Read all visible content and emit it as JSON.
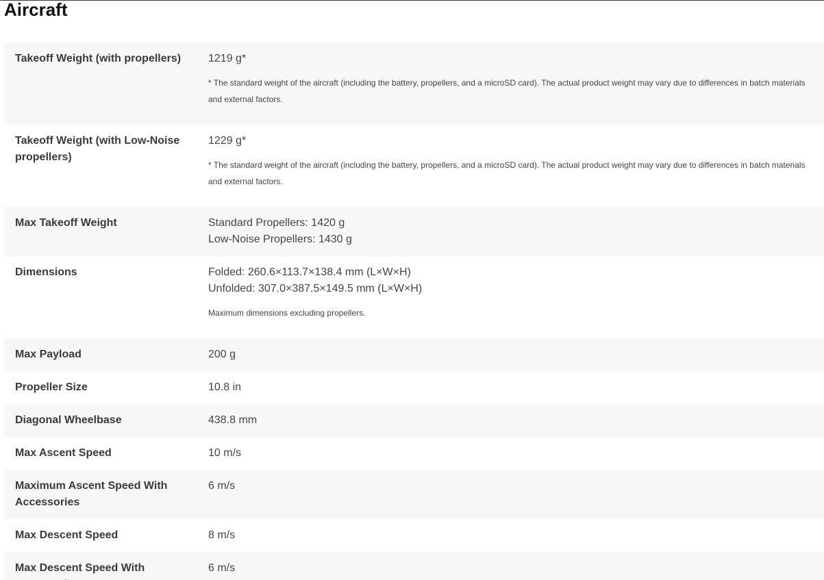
{
  "section": {
    "title": "Aircraft"
  },
  "specs": [
    {
      "label": "Takeoff Weight (with propellers)",
      "values": [
        "1219 g*"
      ],
      "note": "* The standard weight of the aircraft (including the battery, propellers, and a microSD card). The actual product weight may vary due to differences in batch materials and external factors."
    },
    {
      "label": "Takeoff Weight (with Low-Noise propellers)",
      "values": [
        "1229 g*"
      ],
      "note": "* The standard weight of the aircraft (including the battery, propellers, and a microSD card). The actual product weight may vary due to differences in batch materials and external factors."
    },
    {
      "label": "Max Takeoff Weight",
      "values": [
        "Standard Propellers: 1420 g",
        "Low-Noise Propellers: 1430 g"
      ]
    },
    {
      "label": "Dimensions",
      "values": [
        "Folded: 260.6×113.7×138.4 mm (L×W×H)",
        "Unfolded: 307.0×387.5×149.5 mm (L×W×H)"
      ],
      "note": "Maximum dimensions excluding propellers."
    },
    {
      "label": "Max Payload",
      "values": [
        "200 g"
      ]
    },
    {
      "label": "Propeller Size",
      "values": [
        "10.8 in"
      ]
    },
    {
      "label": "Diagonal Wheelbase",
      "values": [
        "438.8 mm"
      ]
    },
    {
      "label": "Max Ascent Speed",
      "values": [
        "10 m/s"
      ]
    },
    {
      "label": "Maximum Ascent Speed With Accessories",
      "values": [
        "6 m/s"
      ]
    },
    {
      "label": "Max Descent Speed",
      "values": [
        "8 m/s"
      ]
    },
    {
      "label": "Max Descent Speed With Accessories",
      "values": [
        "6 m/s"
      ]
    }
  ]
}
